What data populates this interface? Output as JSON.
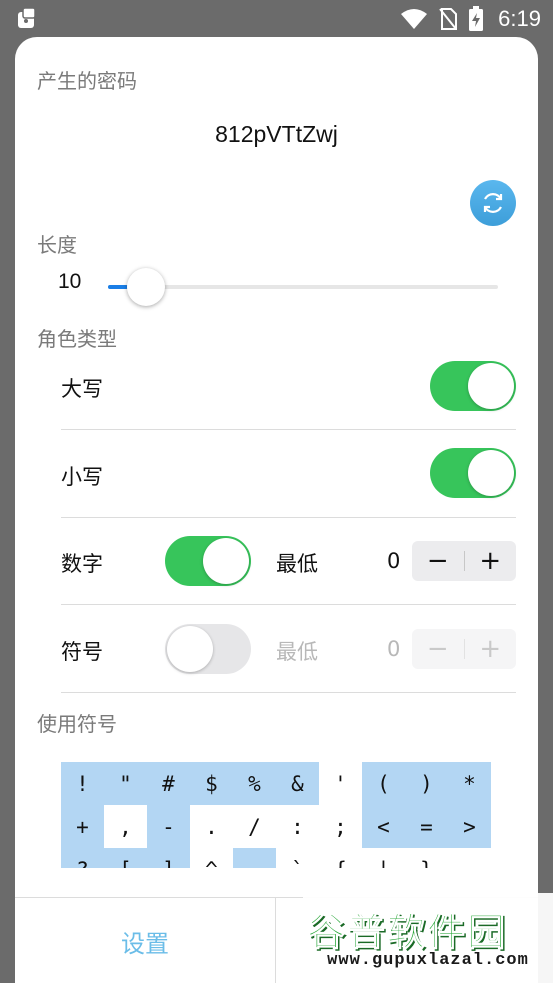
{
  "status_bar": {
    "time": "6:19",
    "icons": [
      "app-notification-icon",
      "wifi-icon",
      "no-sim-icon",
      "battery-charging-icon"
    ]
  },
  "dialog": {
    "generated_label": "产生的密码",
    "password": "812pVTtZwj",
    "length_label": "长度",
    "length_value": "10",
    "length_fraction": 0.1,
    "char_type_label": "角色类型",
    "rows": {
      "upper": {
        "label": "大写",
        "enabled": true
      },
      "lower": {
        "label": "小写",
        "enabled": true
      },
      "digits": {
        "label": "数字",
        "enabled": true,
        "min_label": "最低",
        "min_value": "0",
        "minus": "−",
        "plus": "+"
      },
      "symbols": {
        "label": "符号",
        "enabled": false,
        "min_label": "最低",
        "min_value": "0",
        "minus": "−",
        "plus": "+"
      }
    },
    "use_symbols_label": "使用符号",
    "symbol_rows": [
      [
        "!",
        "\"",
        "#",
        "$",
        "%",
        "&",
        "'",
        "(",
        ")",
        "*"
      ],
      [
        "+",
        ",",
        "-",
        ".",
        "/",
        ":",
        ";",
        "<",
        "=",
        ">"
      ],
      [
        "?",
        "[",
        "]",
        "^",
        "_",
        "`",
        "{",
        "|",
        "}",
        "~"
      ]
    ],
    "symbol_selected": [
      [
        true,
        true,
        true,
        true,
        true,
        true,
        false,
        true,
        true,
        true
      ],
      [
        true,
        false,
        true,
        false,
        false,
        false,
        false,
        true,
        true,
        true
      ],
      [
        true,
        true,
        true,
        false,
        true,
        false,
        false,
        false,
        false,
        false
      ]
    ],
    "set_button": "设置"
  },
  "watermark": {
    "title": "谷普软件园",
    "url": "www.gupuxlazal.com"
  },
  "colors": {
    "toggle_on": "#37c55b",
    "accent_blue": "#1a7ee6",
    "symbol_selected": "#b3d6f3",
    "set_button_text": "#6bbde8"
  }
}
